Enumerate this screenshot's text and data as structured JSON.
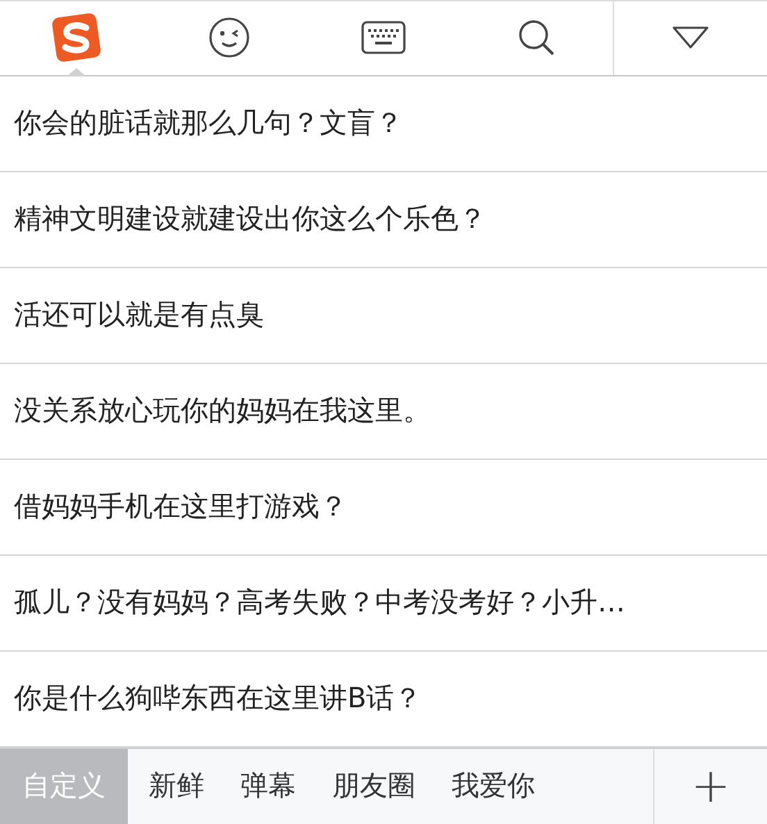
{
  "toolbar": {
    "items": [
      {
        "kind": "logo",
        "selected": true
      },
      {
        "kind": "emoji",
        "selected": false
      },
      {
        "kind": "keyboard",
        "selected": false
      },
      {
        "kind": "search",
        "selected": false
      },
      {
        "kind": "collapse",
        "selected": false
      }
    ]
  },
  "phrases": [
    "你会的脏话就那么几句？文盲？",
    "精神文明建设就建设出你这么个乐色？",
    "活还可以就是有点臭",
    "没关系放心玩你的妈妈在我这里。",
    "借妈妈手机在这里打游戏？",
    "孤儿？没有妈妈？高考失败？中考没考好？小升…",
    "你是什么狗哔东西在这里讲B话？"
  ],
  "categories": [
    {
      "label": "自定义",
      "selected": true
    },
    {
      "label": "新鲜",
      "selected": false
    },
    {
      "label": "弹幕",
      "selected": false
    },
    {
      "label": "朋友圈",
      "selected": false
    },
    {
      "label": "我爱你",
      "selected": false
    }
  ],
  "add_button": {
    "label": "+"
  }
}
